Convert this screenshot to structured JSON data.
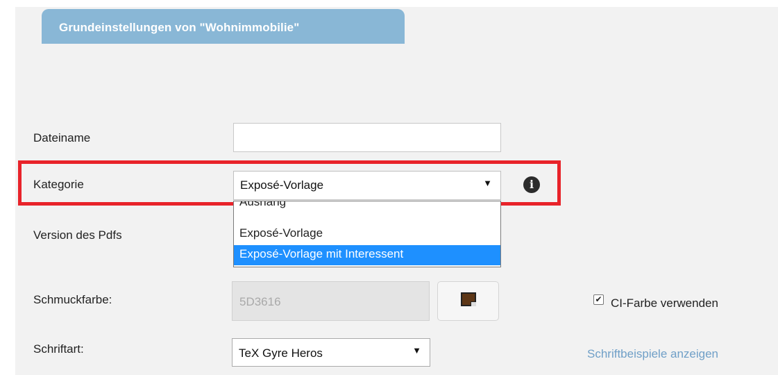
{
  "tab": {
    "title": "Grundeinstellungen von \"Wohnimmobilie\""
  },
  "form": {
    "dateiname": {
      "label": "Dateiname",
      "value": ""
    },
    "kategorie": {
      "label": "Kategorie",
      "selected": "Exposé-Vorlage",
      "options": [
        "Aushang",
        "Exposé-Vorlage",
        "Exposé-Vorlage mit Interessent"
      ],
      "highlighted_option": "Exposé-Vorlage mit Interessent"
    },
    "version": {
      "label": "Version des Pdfs"
    },
    "schmuckfarbe": {
      "label": "Schmuckfarbe:",
      "value": "5D3616",
      "swatch_color": "#5D3616"
    },
    "ci_farbe": {
      "label": "CI-Farbe verwenden",
      "checked": true
    },
    "schriftart": {
      "label": "Schriftart:",
      "selected": "TeX Gyre Heros"
    },
    "schriftbeispiele_link": "Schriftbeispiele anzeigen"
  },
  "icons": {
    "info": "info-icon",
    "dropdown_arrow": "▼",
    "checkmark": "✔"
  },
  "colors": {
    "tab": "#89B7D6",
    "highlight_border": "#E8232A",
    "selected_option": "#1E90FF",
    "link": "#6F9FC7"
  }
}
